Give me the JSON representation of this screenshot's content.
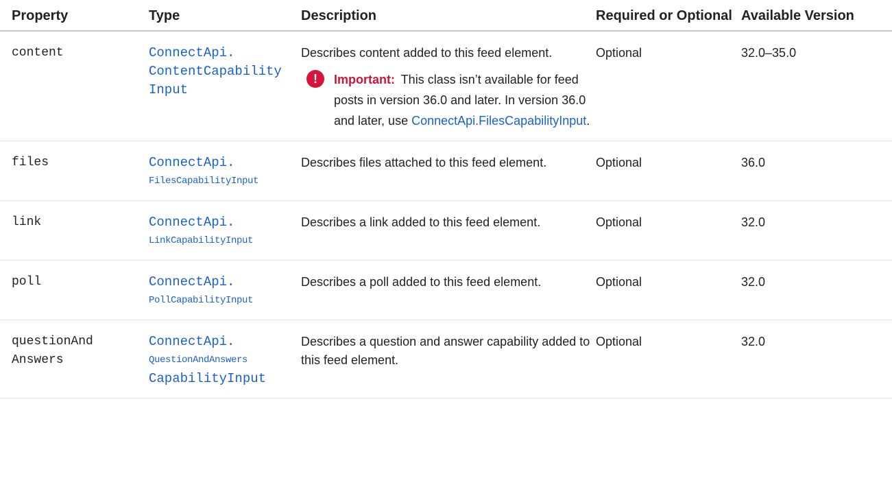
{
  "columns": {
    "property": "Property",
    "type": "Type",
    "description": "Description",
    "required": "Required or Optional",
    "version": "Available Version"
  },
  "rows": [
    {
      "property": "content",
      "type_lines": [
        "ConnectApi.",
        "ContentCapability",
        "Input"
      ],
      "description": "Describes content added to this feed element.",
      "required": "Optional",
      "version": "32.0–35.0",
      "note": {
        "label": "Important:",
        "text": "This class isn’t available for feed posts in version 36.0 and later. In version 36.0 and later, use ",
        "link": "ConnectApi.FilesCapabilityInput",
        "end": "."
      }
    },
    {
      "property": "files",
      "type_lines": [
        "ConnectApi.",
        "FilesCapabilityInput"
      ],
      "description": "Describes files attached to this feed element.",
      "required": "Optional",
      "version": "36.0"
    },
    {
      "property": "link",
      "type_lines": [
        "ConnectApi.",
        "LinkCapabilityInput"
      ],
      "description": "Describes a link added to this feed element.",
      "required": "Optional",
      "version": "32.0"
    },
    {
      "property": "poll",
      "type_lines": [
        "ConnectApi.",
        "PollCapabilityInput"
      ],
      "description": "Describes a poll added to this feed element.",
      "required": "Optional",
      "version": "32.0"
    },
    {
      "property_lines": [
        "questionAnd",
        "Answers"
      ],
      "type_lines": [
        "ConnectApi.",
        "QuestionAndAnswers",
        "CapabilityInput"
      ],
      "description": "Describes a question and answer capability added to this feed element.",
      "required": "Optional",
      "version": "32.0"
    }
  ],
  "icons": {
    "important": "exclamation-circle-icon"
  },
  "colors": {
    "link": "#1a62c8",
    "important": "#c9163a"
  }
}
